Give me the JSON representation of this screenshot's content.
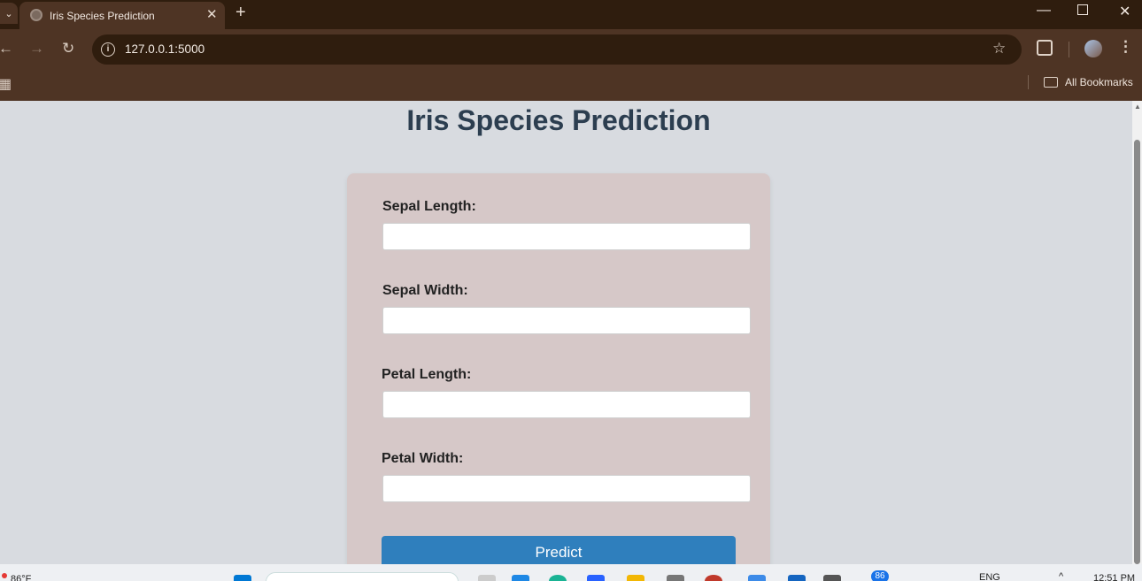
{
  "browser": {
    "tab_title": "Iris Species Prediction",
    "url": "127.0.0.1:5000",
    "bookmarks_label": "All Bookmarks"
  },
  "page": {
    "heading": "Iris Species Prediction",
    "fields": [
      {
        "label": "Sepal Length:",
        "value": ""
      },
      {
        "label": "Sepal Width:",
        "value": ""
      },
      {
        "label": "Petal Length:",
        "value": ""
      },
      {
        "label": "Petal Width:",
        "value": ""
      }
    ],
    "submit_label": "Predict"
  },
  "taskbar": {
    "weather": "86°F",
    "language": "ENG",
    "time": "12:51 PM",
    "notification_count": "86"
  }
}
